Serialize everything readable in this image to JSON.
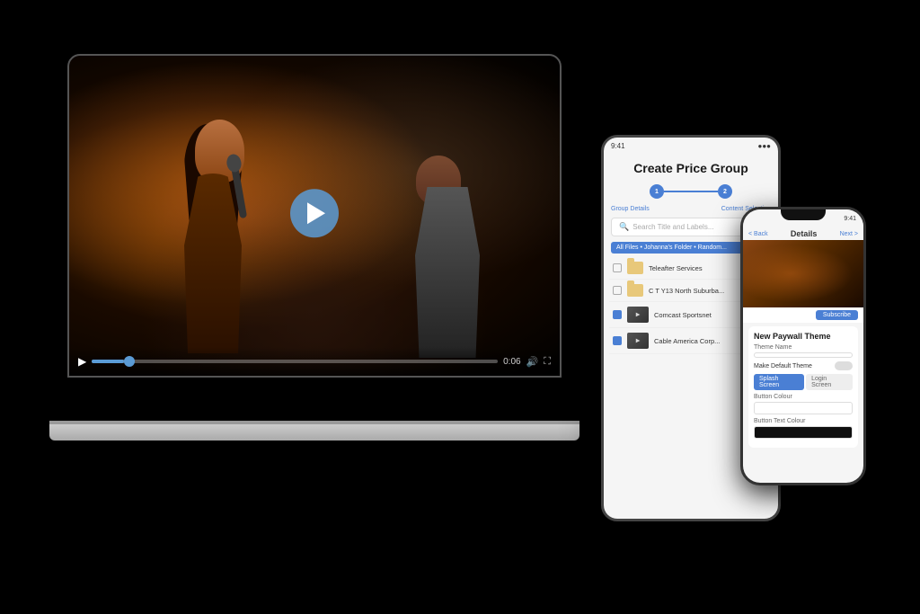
{
  "scene": {
    "bg_color": "#000000"
  },
  "laptop": {
    "video": {
      "time": "0:06",
      "progress_percent": 8
    },
    "controls": {
      "play_label": "▶",
      "volume_label": "🔊",
      "fullscreen_label": "⛶"
    }
  },
  "tablet": {
    "status_bar": {
      "left": "9:41",
      "right": "●●●"
    },
    "title": "Create Price Group",
    "stepper": {
      "step1_label": "Group Details",
      "step2_label": "Content Selection",
      "step1_num": "1",
      "step2_num": "2"
    },
    "search": {
      "placeholder": "Search Title and Labels..."
    },
    "breadcrumb": "All Files • Johanna's Folder • Random...",
    "files": [
      {
        "name": "Teleafter Services",
        "type": "folder",
        "checked": false
      },
      {
        "name": "C T Y13 North Suburba...",
        "type": "folder",
        "checked": false
      },
      {
        "name": "Comcast Sportsnet",
        "type": "video",
        "checked": true
      },
      {
        "name": "Cable America Corp...",
        "type": "video",
        "checked": true
      }
    ]
  },
  "phone": {
    "status_bar": {
      "right": "9:41"
    },
    "header": {
      "back_label": "< Back",
      "title": "Details",
      "next_label": "Next >"
    },
    "section_title": "New Paywall Theme",
    "fields": {
      "theme_name_label": "Theme Name",
      "theme_name_value": "",
      "make_default_label": "Make Default Theme",
      "tabs": [
        "Splash Screen",
        "Login Screen"
      ],
      "button_colour_label": "Button Colour",
      "button_colour_value": "#ffffff",
      "button_text_colour_label": "Button Text Colour",
      "button_text_colour_value": "#0f0f0f"
    }
  }
}
